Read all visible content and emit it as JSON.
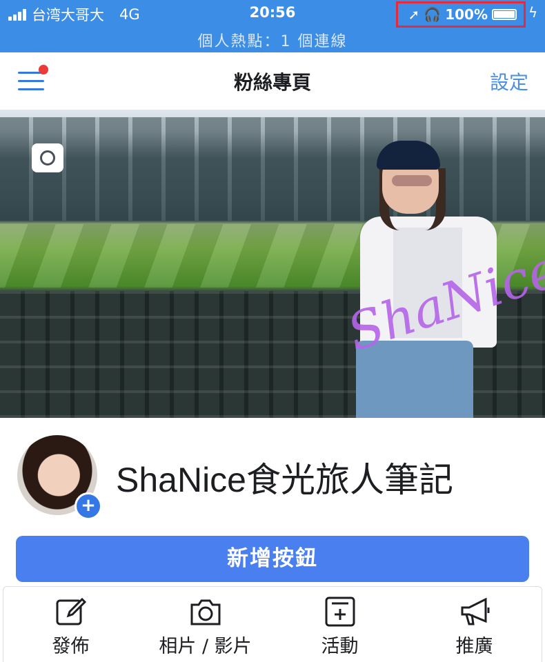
{
  "status_bar": {
    "carrier": "台湾大哥大",
    "network": "4G",
    "time": "20:56",
    "battery": "100%",
    "hotspot": "個人熱點：1 個連線",
    "battery_level": 1.0,
    "icons": [
      "signal-icon",
      "location-arrow-icon",
      "headphones-icon",
      "battery-icon",
      "charging-icon"
    ]
  },
  "nav": {
    "title": "粉絲專頁",
    "settings": "設定",
    "menu_has_notification": true
  },
  "profile": {
    "name": "ShaNice食光旅人筆記",
    "add_photo_symbol": "+"
  },
  "cover": {
    "signature": "ShaNice"
  },
  "add_button": {
    "label": "新增按鈕"
  },
  "actions": [
    {
      "label": "發佈",
      "icon": "compose-icon"
    },
    {
      "label": "相片 / 影片",
      "icon": "camera-icon"
    },
    {
      "label": "活動",
      "icon": "event-icon"
    },
    {
      "label": "推廣",
      "icon": "megaphone-icon"
    }
  ],
  "colors": {
    "status_bar": "#3b8de6",
    "accent": "#3578e5",
    "primary_button": "#4a7ff0",
    "highlight_box": "#e52b3a",
    "notification_dot": "#ea3b36"
  }
}
